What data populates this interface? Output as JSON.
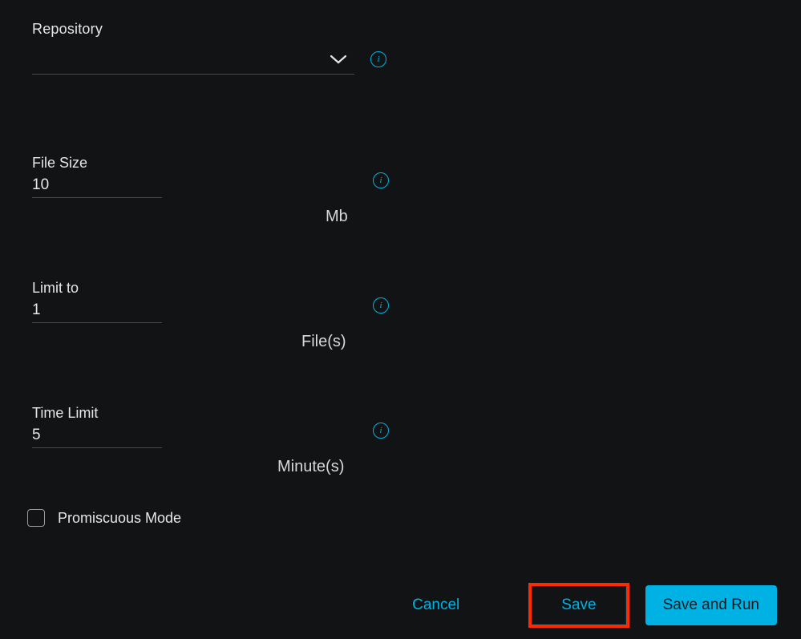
{
  "fields": {
    "repository": {
      "label": "Repository",
      "value": ""
    },
    "fileSize": {
      "label": "File Size",
      "value": "10",
      "unit": "Mb"
    },
    "limitTo": {
      "label": "Limit to",
      "value": "1",
      "unit": "File(s)"
    },
    "timeLimit": {
      "label": "Time Limit",
      "value": "5",
      "unit": "Minute(s)"
    },
    "promiscuous": {
      "label": "Promiscuous Mode",
      "checked": false
    }
  },
  "buttons": {
    "cancel": "Cancel",
    "save": "Save",
    "saveRun": "Save and Run"
  },
  "info_glyph": "i"
}
